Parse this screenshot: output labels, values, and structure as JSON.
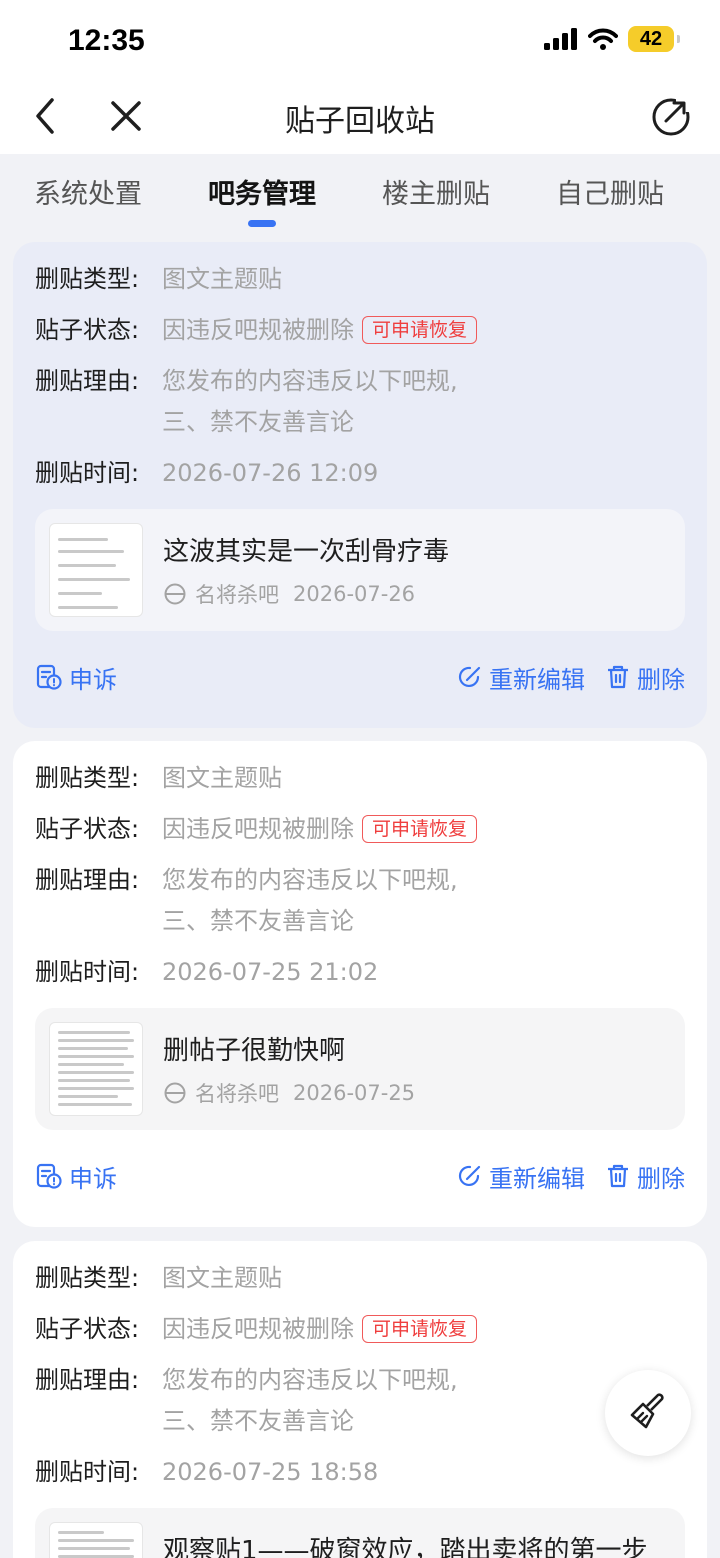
{
  "status_bar": {
    "time": "12:35",
    "battery": "42"
  },
  "nav": {
    "title": "贴子回收站"
  },
  "tabs": [
    {
      "label": "系统处置"
    },
    {
      "label": "吧务管理"
    },
    {
      "label": "楼主删贴"
    },
    {
      "label": "自己删贴"
    }
  ],
  "labels": {
    "type": "删贴类型:",
    "status": "贴子状态:",
    "reason": "删贴理由:",
    "time": "删贴时间:",
    "appeal": "申诉",
    "reedit": "重新编辑",
    "delete": "删除"
  },
  "records": [
    {
      "type": "图文主题贴",
      "status": "因违反吧规被删除",
      "badge": "可申请恢复",
      "reason_line1": "您发布的内容违反以下吧规,",
      "reason_line2": "三、禁不友善言论",
      "time": "2026-07-26 12:09",
      "post_title": "这波其实是一次刮骨疗毒",
      "post_bar": "名将杀吧",
      "post_date": "2026-07-26"
    },
    {
      "type": "图文主题贴",
      "status": "因违反吧规被删除",
      "badge": "可申请恢复",
      "reason_line1": "您发布的内容违反以下吧规,",
      "reason_line2": "三、禁不友善言论",
      "time": "2026-07-25 21:02",
      "post_title": "删帖子很勤快啊",
      "post_bar": "名将杀吧",
      "post_date": "2026-07-25"
    },
    {
      "type": "图文主题贴",
      "status": "因违反吧规被删除",
      "badge": "可申请恢复",
      "reason_line1": "您发布的内容违反以下吧规,",
      "reason_line2": "三、禁不友善言论",
      "time": "2026-07-25 18:58",
      "post_title": "观察贴1——破窗效应，踏出卖将的第一步"
    }
  ],
  "colors": {
    "accent": "#3873f3",
    "badge_red": "#ef3e3e",
    "highlight_card": "#e9ecf7"
  }
}
